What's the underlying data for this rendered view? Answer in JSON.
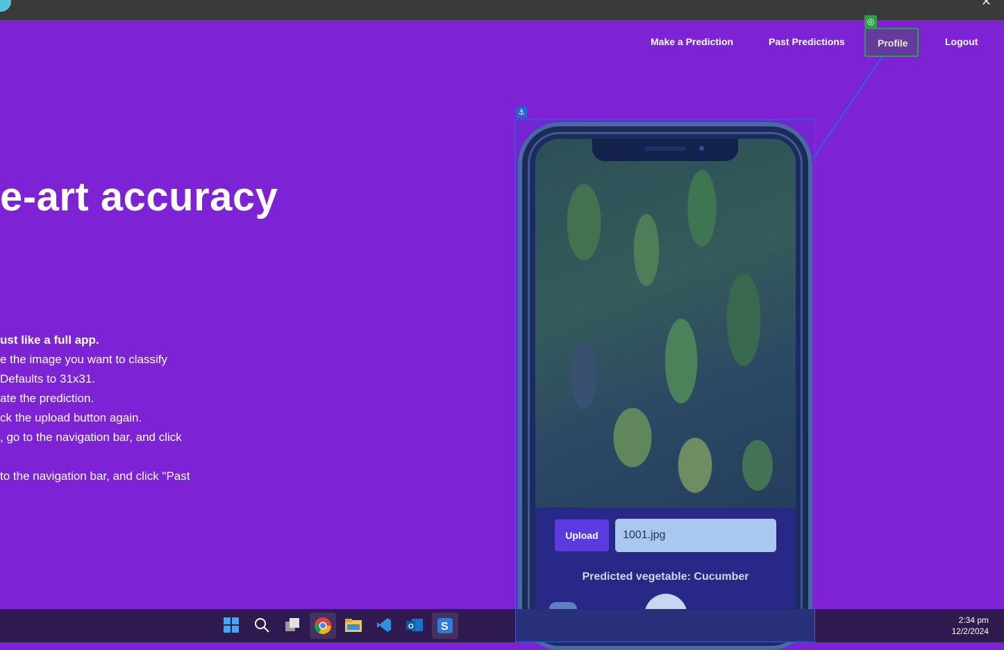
{
  "nav": {
    "make_prediction": "Make a Prediction",
    "past_predictions": "Past Predictions",
    "profile": "Profile",
    "logout": "Logout"
  },
  "hero": {
    "title": "e-art accuracy",
    "lines": [
      "ust like a full app.",
      "e the image you want to classify",
      "Defaults to 31x31.",
      "ate the prediction.",
      "ck the upload button again.",
      ", go to the navigation bar, and click",
      "to the navigation bar, and click \"Past"
    ]
  },
  "phone": {
    "upload_label": "Upload",
    "file_name": "1001.jpg",
    "prediction_text": "Predicted vegetable: Cucumber"
  },
  "taskbar": {
    "icons": [
      "windows-start-icon",
      "search-icon",
      "task-view-icon",
      "chrome-icon",
      "file-explorer-icon",
      "vscode-icon",
      "outlook-icon",
      "app-s-icon"
    ],
    "time": "2:34 pm",
    "date": "12/2/2024"
  },
  "colors": {
    "background": "#7d22d4",
    "accent": "#5a3be0",
    "selection": "#3a5bd8",
    "focus": "#2e9e4a"
  }
}
